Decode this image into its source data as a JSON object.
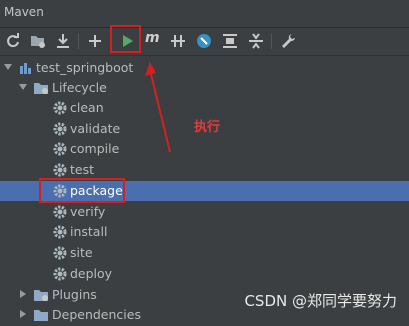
{
  "header": {
    "title": "Maven"
  },
  "toolbar": {
    "buttons": [
      {
        "name": "reload-icon"
      },
      {
        "name": "generate-sources-icon"
      },
      {
        "name": "download-icon"
      },
      {
        "name": "add-icon"
      },
      {
        "name": "run-icon"
      },
      {
        "name": "execute-goal-icon",
        "text": "m"
      },
      {
        "name": "toggle-offline-icon"
      },
      {
        "name": "skip-tests-icon"
      },
      {
        "name": "show-dependencies-icon"
      },
      {
        "name": "collapse-all-icon"
      },
      {
        "name": "settings-icon"
      }
    ]
  },
  "tree": {
    "project": "test_springboot",
    "lifecycle_label": "Lifecycle",
    "goals": [
      "clean",
      "validate",
      "compile",
      "test",
      "package",
      "verify",
      "install",
      "site",
      "deploy"
    ],
    "selected_goal": "package",
    "plugins_label": "Plugins",
    "dependencies_label": "Dependencies"
  },
  "annotation": {
    "label": "执行"
  },
  "watermark": "CSDN @郑同学要努力",
  "colors": {
    "accent": "#d12121",
    "selection": "#4b6eaf",
    "run_green": "#59a869",
    "background": "#3c3f41"
  }
}
